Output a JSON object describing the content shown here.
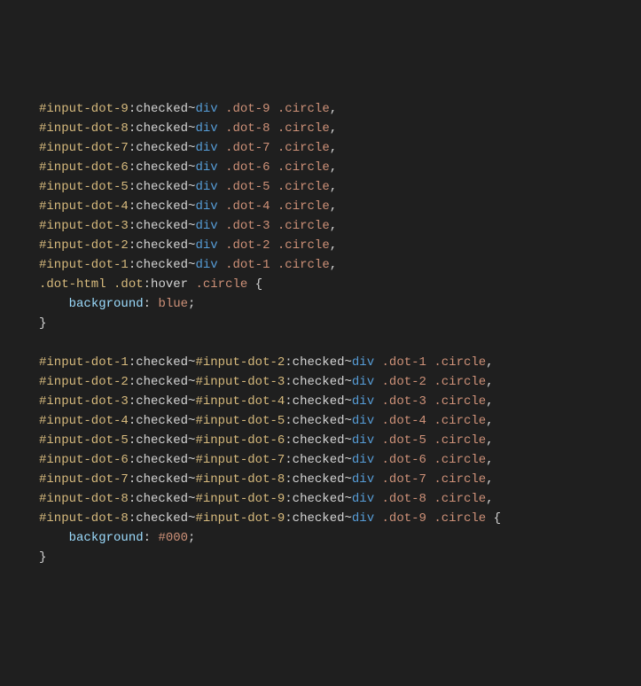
{
  "block1": {
    "lines": [
      {
        "id": "#input-dot-9",
        "dot": ".dot-9"
      },
      {
        "id": "#input-dot-8",
        "dot": ".dot-8"
      },
      {
        "id": "#input-dot-7",
        "dot": ".dot-7"
      },
      {
        "id": "#input-dot-6",
        "dot": ".dot-6"
      },
      {
        "id": "#input-dot-5",
        "dot": ".dot-5"
      },
      {
        "id": "#input-dot-4",
        "dot": ".dot-4"
      },
      {
        "id": "#input-dot-3",
        "dot": ".dot-3"
      },
      {
        "id": "#input-dot-2",
        "dot": ".dot-2"
      },
      {
        "id": "#input-dot-1",
        "dot": ".dot-1"
      }
    ],
    "pseudo": ":checked",
    "tilde": "~",
    "tag": "div",
    "circle": ".circle",
    "comma": ",",
    "hover_sel_class1": ".dot-html",
    "hover_sel_class2": ".dot",
    "hover_pseudo": ":hover",
    "brace_open": "{",
    "prop": "background",
    "colon": ":",
    "value": "blue",
    "semi": ";",
    "brace_close": "}"
  },
  "block2": {
    "lines": [
      {
        "id1": "#input-dot-1",
        "id2": "#input-dot-2",
        "dot": ".dot-1"
      },
      {
        "id1": "#input-dot-2",
        "id2": "#input-dot-3",
        "dot": ".dot-2"
      },
      {
        "id1": "#input-dot-3",
        "id2": "#input-dot-4",
        "dot": ".dot-3"
      },
      {
        "id1": "#input-dot-4",
        "id2": "#input-dot-5",
        "dot": ".dot-4"
      },
      {
        "id1": "#input-dot-5",
        "id2": "#input-dot-6",
        "dot": ".dot-5"
      },
      {
        "id1": "#input-dot-6",
        "id2": "#input-dot-7",
        "dot": ".dot-6"
      },
      {
        "id1": "#input-dot-7",
        "id2": "#input-dot-8",
        "dot": ".dot-7"
      },
      {
        "id1": "#input-dot-8",
        "id2": "#input-dot-9",
        "dot": ".dot-8"
      },
      {
        "id1": "#input-dot-8",
        "id2": "#input-dot-9",
        "dot": ".dot-9"
      }
    ],
    "pseudo": ":checked",
    "tilde": "~",
    "tag": "div",
    "circle": ".circle",
    "comma": ",",
    "brace_open": "{",
    "prop": "background",
    "colon": ":",
    "value": "#000",
    "semi": ";",
    "brace_close": "}"
  }
}
